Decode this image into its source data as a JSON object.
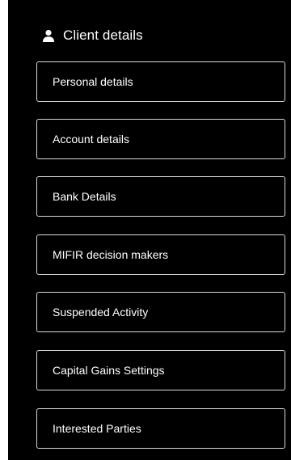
{
  "header": {
    "title": "Client details",
    "icon": "user-icon"
  },
  "menu": {
    "items": [
      {
        "label": "Personal details"
      },
      {
        "label": "Account details"
      },
      {
        "label": "Bank Details"
      },
      {
        "label": "MIFIR decision makers"
      },
      {
        "label": "Suspended Activity"
      },
      {
        "label": "Capital Gains Settings"
      },
      {
        "label": "Interested Parties"
      }
    ]
  },
  "colors": {
    "background": "#000000",
    "text": "#ffffff",
    "border": "#d9d9d9"
  }
}
